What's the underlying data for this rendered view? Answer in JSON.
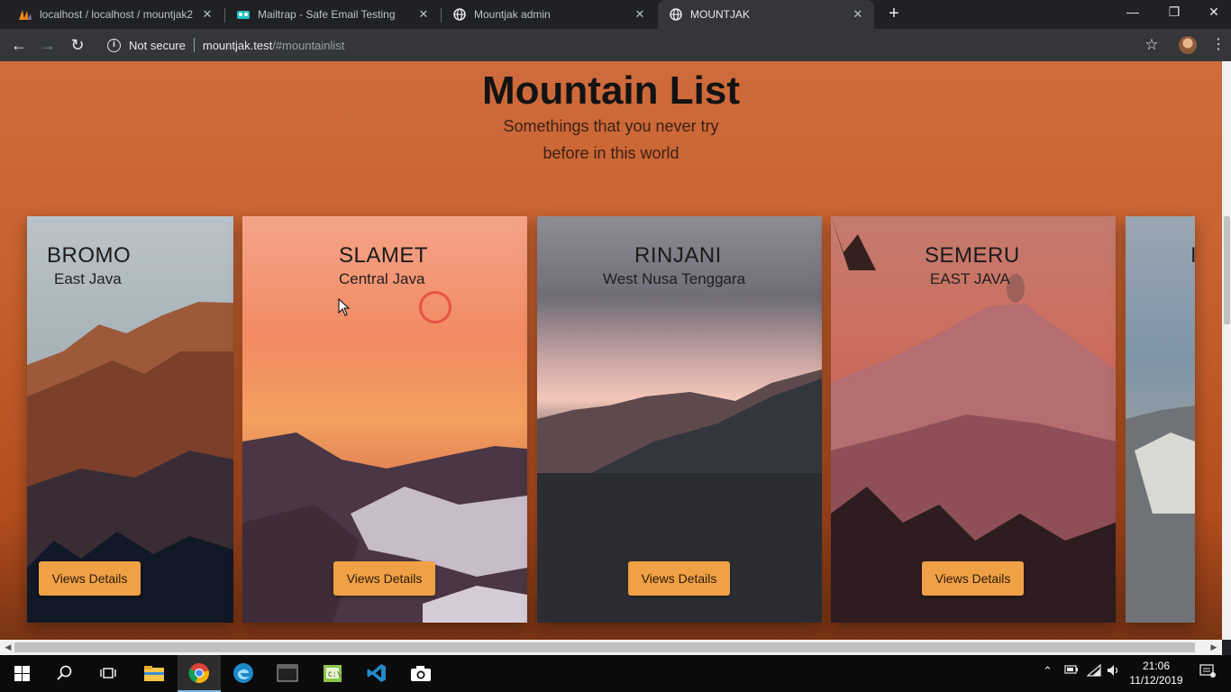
{
  "tabs": [
    {
      "title": "localhost / localhost / mountjak2",
      "favicon": "phpmyadmin-icon"
    },
    {
      "title": "Mailtrap - Safe Email Testing",
      "favicon": "mailtrap-icon"
    },
    {
      "title": "Mountjak admin",
      "favicon": "globe-icon"
    },
    {
      "title": "MOUNTJAK",
      "favicon": "globe-icon",
      "active": true
    }
  ],
  "omnibox": {
    "security_label": "Not secure",
    "url_host": "mountjak.test",
    "url_path": "/#mountainlist"
  },
  "page": {
    "title": "Mountain List",
    "subtitle_line1": "Somethings that you never try",
    "subtitle_line2": "before in this world"
  },
  "mountains": [
    {
      "name": "BROMO",
      "region": "East Java",
      "button": "Views Details"
    },
    {
      "name": "SLAMET",
      "region": "Central Java",
      "button": "Views Details"
    },
    {
      "name": "RINJANI",
      "region": "West Nusa Tenggara",
      "button": "Views Details"
    },
    {
      "name": "SEMERU",
      "region": "EAST JAVA",
      "button": "Views Details"
    }
  ],
  "taskbar": {
    "time": "21:06",
    "date": "11/12/2019",
    "pinned": [
      "file-explorer-icon",
      "chrome-icon",
      "edge-icon",
      "terminal-icon",
      "notepad-plus-icon",
      "vscode-icon",
      "camera-icon"
    ]
  },
  "colors": {
    "page_background": "#c9622f",
    "button": "#f0a145",
    "title": "#131313"
  }
}
